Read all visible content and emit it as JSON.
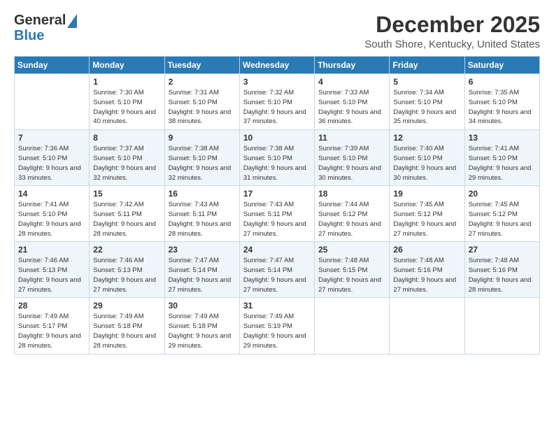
{
  "logo": {
    "general": "General",
    "blue": "Blue"
  },
  "header": {
    "title": "December 2025",
    "subtitle": "South Shore, Kentucky, United States"
  },
  "weekdays": [
    "Sunday",
    "Monday",
    "Tuesday",
    "Wednesday",
    "Thursday",
    "Friday",
    "Saturday"
  ],
  "weeks": [
    [
      {
        "day": "",
        "sunrise": "",
        "sunset": "",
        "daylight": ""
      },
      {
        "day": "1",
        "sunrise": "Sunrise: 7:30 AM",
        "sunset": "Sunset: 5:10 PM",
        "daylight": "Daylight: 9 hours and 40 minutes."
      },
      {
        "day": "2",
        "sunrise": "Sunrise: 7:31 AM",
        "sunset": "Sunset: 5:10 PM",
        "daylight": "Daylight: 9 hours and 38 minutes."
      },
      {
        "day": "3",
        "sunrise": "Sunrise: 7:32 AM",
        "sunset": "Sunset: 5:10 PM",
        "daylight": "Daylight: 9 hours and 37 minutes."
      },
      {
        "day": "4",
        "sunrise": "Sunrise: 7:33 AM",
        "sunset": "Sunset: 5:10 PM",
        "daylight": "Daylight: 9 hours and 36 minutes."
      },
      {
        "day": "5",
        "sunrise": "Sunrise: 7:34 AM",
        "sunset": "Sunset: 5:10 PM",
        "daylight": "Daylight: 9 hours and 35 minutes."
      },
      {
        "day": "6",
        "sunrise": "Sunrise: 7:35 AM",
        "sunset": "Sunset: 5:10 PM",
        "daylight": "Daylight: 9 hours and 34 minutes."
      }
    ],
    [
      {
        "day": "7",
        "sunrise": "Sunrise: 7:36 AM",
        "sunset": "Sunset: 5:10 PM",
        "daylight": "Daylight: 9 hours and 33 minutes."
      },
      {
        "day": "8",
        "sunrise": "Sunrise: 7:37 AM",
        "sunset": "Sunset: 5:10 PM",
        "daylight": "Daylight: 9 hours and 32 minutes."
      },
      {
        "day": "9",
        "sunrise": "Sunrise: 7:38 AM",
        "sunset": "Sunset: 5:10 PM",
        "daylight": "Daylight: 9 hours and 32 minutes."
      },
      {
        "day": "10",
        "sunrise": "Sunrise: 7:38 AM",
        "sunset": "Sunset: 5:10 PM",
        "daylight": "Daylight: 9 hours and 31 minutes."
      },
      {
        "day": "11",
        "sunrise": "Sunrise: 7:39 AM",
        "sunset": "Sunset: 5:10 PM",
        "daylight": "Daylight: 9 hours and 30 minutes."
      },
      {
        "day": "12",
        "sunrise": "Sunrise: 7:40 AM",
        "sunset": "Sunset: 5:10 PM",
        "daylight": "Daylight: 9 hours and 30 minutes."
      },
      {
        "day": "13",
        "sunrise": "Sunrise: 7:41 AM",
        "sunset": "Sunset: 5:10 PM",
        "daylight": "Daylight: 9 hours and 29 minutes."
      }
    ],
    [
      {
        "day": "14",
        "sunrise": "Sunrise: 7:41 AM",
        "sunset": "Sunset: 5:10 PM",
        "daylight": "Daylight: 9 hours and 28 minutes."
      },
      {
        "day": "15",
        "sunrise": "Sunrise: 7:42 AM",
        "sunset": "Sunset: 5:11 PM",
        "daylight": "Daylight: 9 hours and 28 minutes."
      },
      {
        "day": "16",
        "sunrise": "Sunrise: 7:43 AM",
        "sunset": "Sunset: 5:11 PM",
        "daylight": "Daylight: 9 hours and 28 minutes."
      },
      {
        "day": "17",
        "sunrise": "Sunrise: 7:43 AM",
        "sunset": "Sunset: 5:11 PM",
        "daylight": "Daylight: 9 hours and 27 minutes."
      },
      {
        "day": "18",
        "sunrise": "Sunrise: 7:44 AM",
        "sunset": "Sunset: 5:12 PM",
        "daylight": "Daylight: 9 hours and 27 minutes."
      },
      {
        "day": "19",
        "sunrise": "Sunrise: 7:45 AM",
        "sunset": "Sunset: 5:12 PM",
        "daylight": "Daylight: 9 hours and 27 minutes."
      },
      {
        "day": "20",
        "sunrise": "Sunrise: 7:45 AM",
        "sunset": "Sunset: 5:12 PM",
        "daylight": "Daylight: 9 hours and 27 minutes."
      }
    ],
    [
      {
        "day": "21",
        "sunrise": "Sunrise: 7:46 AM",
        "sunset": "Sunset: 5:13 PM",
        "daylight": "Daylight: 9 hours and 27 minutes."
      },
      {
        "day": "22",
        "sunrise": "Sunrise: 7:46 AM",
        "sunset": "Sunset: 5:13 PM",
        "daylight": "Daylight: 9 hours and 27 minutes."
      },
      {
        "day": "23",
        "sunrise": "Sunrise: 7:47 AM",
        "sunset": "Sunset: 5:14 PM",
        "daylight": "Daylight: 9 hours and 27 minutes."
      },
      {
        "day": "24",
        "sunrise": "Sunrise: 7:47 AM",
        "sunset": "Sunset: 5:14 PM",
        "daylight": "Daylight: 9 hours and 27 minutes."
      },
      {
        "day": "25",
        "sunrise": "Sunrise: 7:48 AM",
        "sunset": "Sunset: 5:15 PM",
        "daylight": "Daylight: 9 hours and 27 minutes."
      },
      {
        "day": "26",
        "sunrise": "Sunrise: 7:48 AM",
        "sunset": "Sunset: 5:16 PM",
        "daylight": "Daylight: 9 hours and 27 minutes."
      },
      {
        "day": "27",
        "sunrise": "Sunrise: 7:48 AM",
        "sunset": "Sunset: 5:16 PM",
        "daylight": "Daylight: 9 hours and 28 minutes."
      }
    ],
    [
      {
        "day": "28",
        "sunrise": "Sunrise: 7:49 AM",
        "sunset": "Sunset: 5:17 PM",
        "daylight": "Daylight: 9 hours and 28 minutes."
      },
      {
        "day": "29",
        "sunrise": "Sunrise: 7:49 AM",
        "sunset": "Sunset: 5:18 PM",
        "daylight": "Daylight: 9 hours and 28 minutes."
      },
      {
        "day": "30",
        "sunrise": "Sunrise: 7:49 AM",
        "sunset": "Sunset: 5:18 PM",
        "daylight": "Daylight: 9 hours and 29 minutes."
      },
      {
        "day": "31",
        "sunrise": "Sunrise: 7:49 AM",
        "sunset": "Sunset: 5:19 PM",
        "daylight": "Daylight: 9 hours and 29 minutes."
      },
      {
        "day": "",
        "sunrise": "",
        "sunset": "",
        "daylight": ""
      },
      {
        "day": "",
        "sunrise": "",
        "sunset": "",
        "daylight": ""
      },
      {
        "day": "",
        "sunrise": "",
        "sunset": "",
        "daylight": ""
      }
    ]
  ]
}
